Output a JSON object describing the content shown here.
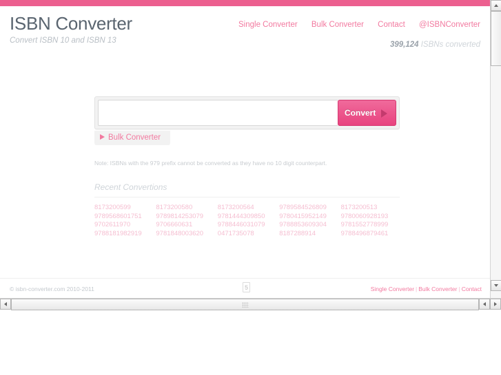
{
  "accent_color": "#ec5f8f",
  "link_color": "#f2799f",
  "header": {
    "title": "ISBN Converter",
    "tagline": "Convert ISBN 10 and ISBN 13",
    "nav": [
      {
        "label": "Single Converter",
        "name": "nav-single-converter"
      },
      {
        "label": "Bulk Converter",
        "name": "nav-bulk-converter"
      },
      {
        "label": "Contact",
        "name": "nav-contact"
      },
      {
        "label": "@ISBNConverter",
        "name": "nav-twitter"
      }
    ],
    "counter_number": "399,124",
    "counter_suffix": " ISBNs converted"
  },
  "converter": {
    "input_value": "",
    "input_placeholder": "",
    "convert_label": "Convert",
    "bulk_tab_label": "Bulk Converter",
    "note": "Note: ISBNs with the 979 prefix cannot be converted as they have no 10 digit counterpart."
  },
  "recent": {
    "title": "Recent Convertions",
    "isbns": [
      "8173200599",
      "8173200580",
      "8173200564",
      "9789584526809",
      "8173200513",
      "9789568601751",
      "9789814253079",
      "9781444309850",
      "9780415952149",
      "9780060928193",
      "9702611970",
      "9706660631",
      "9788446031079",
      "9788853609304",
      "9781552778999",
      "9788181982919",
      "9781848003620",
      "0471735078",
      "8187288914",
      "9788496879461"
    ]
  },
  "footer": {
    "copyright": "© isbn-converter.com 2010-2011",
    "html5_badge": "5",
    "links": [
      {
        "label": "Single Converter",
        "name": "footer-single-converter"
      },
      {
        "label": "Bulk Converter",
        "name": "footer-bulk-converter"
      },
      {
        "label": "Contact",
        "name": "footer-contact"
      }
    ],
    "separator": "|"
  }
}
